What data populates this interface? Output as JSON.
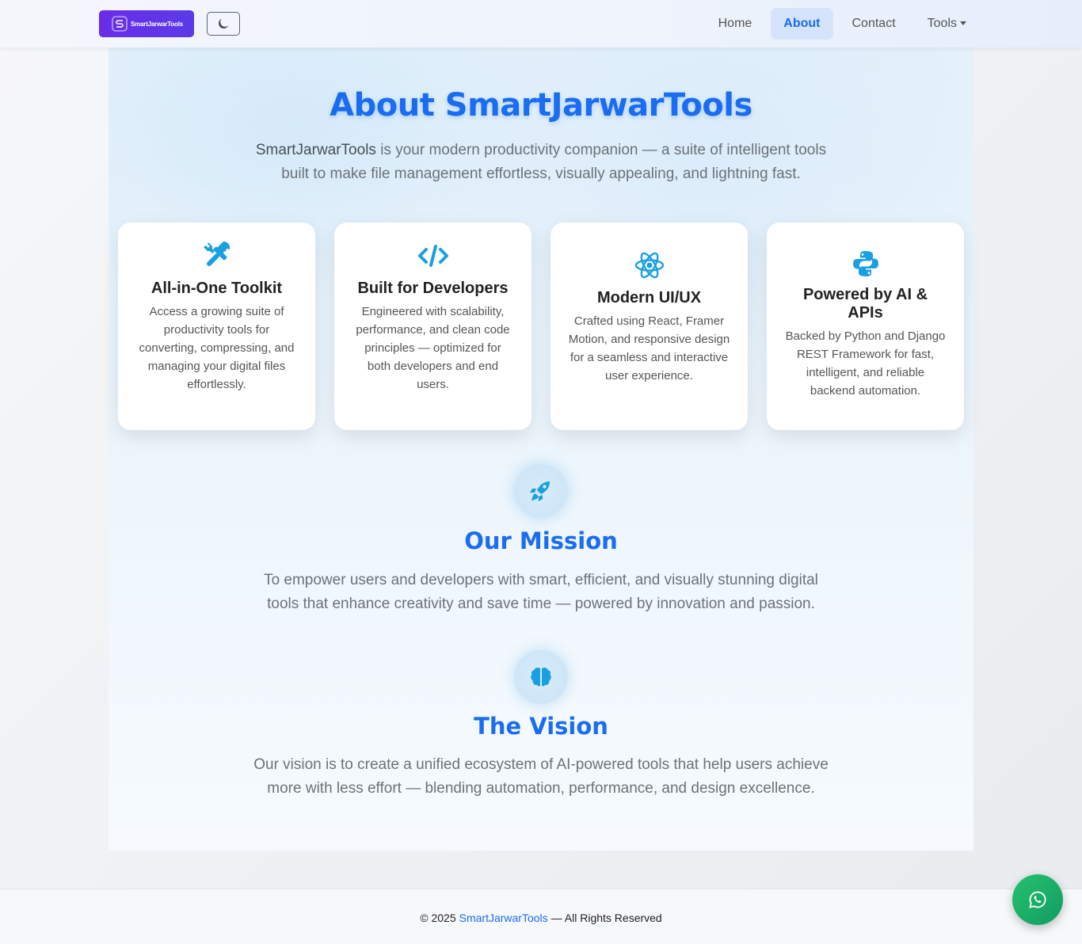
{
  "nav": {
    "brand": "SmartJarwarTools",
    "theme_toggle_icon": "moon-icon",
    "links": [
      {
        "label": "Home",
        "active": false
      },
      {
        "label": "About",
        "active": true
      },
      {
        "label": "Contact",
        "active": false
      },
      {
        "label": "Tools",
        "active": false,
        "dropdown": true
      }
    ]
  },
  "hero": {
    "title": "About SmartJarwarTools",
    "intro_brand": "SmartJarwarTools",
    "intro_rest": " is your modern productivity companion — a suite of intelligent tools built to make file management effortless, visually appealing, and lightning fast."
  },
  "cards": [
    {
      "icon": "tools-icon",
      "title": "All-in-One Toolkit",
      "description": "Access a growing suite of productivity tools for converting, compressing, and managing your digital files effortlessly."
    },
    {
      "icon": "code-icon",
      "title": "Built for Developers",
      "description": "Engineered with scalability, performance, and clean code principles — optimized for both developers and end users."
    },
    {
      "icon": "react-icon",
      "title": "Modern UI/UX",
      "description": "Crafted using React, Framer Motion, and responsive design for a seamless and interactive user experience."
    },
    {
      "icon": "python-icon",
      "title": "Powered by AI & APIs",
      "description": "Backed by Python and Django REST Framework for fast, intelligent, and reliable backend automation."
    }
  ],
  "mission": {
    "icon": "rocket-icon",
    "title": "Our Mission",
    "text": "To empower users and developers with smart, efficient, and visually stunning digital tools that enhance creativity and save time — powered by innovation and passion."
  },
  "vision": {
    "icon": "brain-icon",
    "title": "The Vision",
    "text": "Our vision is to create a unified ecosystem of AI-powered tools that help users achieve more with less effort — blending automation, performance, and design excellence."
  },
  "footer": {
    "prefix": "© 2025",
    "brand": "SmartJarwarTools",
    "suffix": "— All Rights Reserved"
  },
  "colors": {
    "accent": "#1a6cf0",
    "icon_blue": "#1aa0e0",
    "brand_purple": "#6a2ce8",
    "whatsapp_green": "#25c16f"
  },
  "floating": {
    "icon": "whatsapp-icon"
  }
}
